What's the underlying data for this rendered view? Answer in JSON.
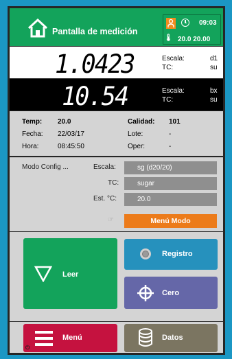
{
  "header": {
    "title": "Pantalla de medición",
    "time": "09:03",
    "temps": "20.0 20.00",
    "icons": [
      "home-icon",
      "user-icon",
      "clock-icon",
      "thermometer-icon"
    ],
    "accent": "#13a35b"
  },
  "reading1": {
    "value": "1.0423",
    "scale_label": "Escala:",
    "scale_value": "d1",
    "tc_label": "TC:",
    "tc_value": "su"
  },
  "reading2": {
    "value": "10.54",
    "scale_label": "Escala:",
    "scale_value": "bx",
    "tc_label": "TC:",
    "tc_value": "su"
  },
  "info": {
    "temp_label": "Temp:",
    "temp_value": "20.0",
    "fecha_label": "Fecha:",
    "fecha_value": "22/03/17",
    "hora_label": "Hora:",
    "hora_value": "08:45:50",
    "calidad_label": "Calidad:",
    "calidad_value": "101",
    "lote_label": "Lote:",
    "lote_value": "-",
    "oper_label": "Oper:",
    "oper_value": "-"
  },
  "config": {
    "mode_label": "Modo Config ...",
    "escala_label": "Escala:",
    "escala_value": "sg (d20/20)",
    "tc_label": "TC:",
    "tc_value": "sugar",
    "est_label": "Est. °C:",
    "est_value": "20.0",
    "menu_modo": "Menú Modo"
  },
  "buttons": {
    "leer": "Leer",
    "registro": "Registro",
    "cero": "Cero",
    "menu": "Menú",
    "datos": "Datos"
  }
}
